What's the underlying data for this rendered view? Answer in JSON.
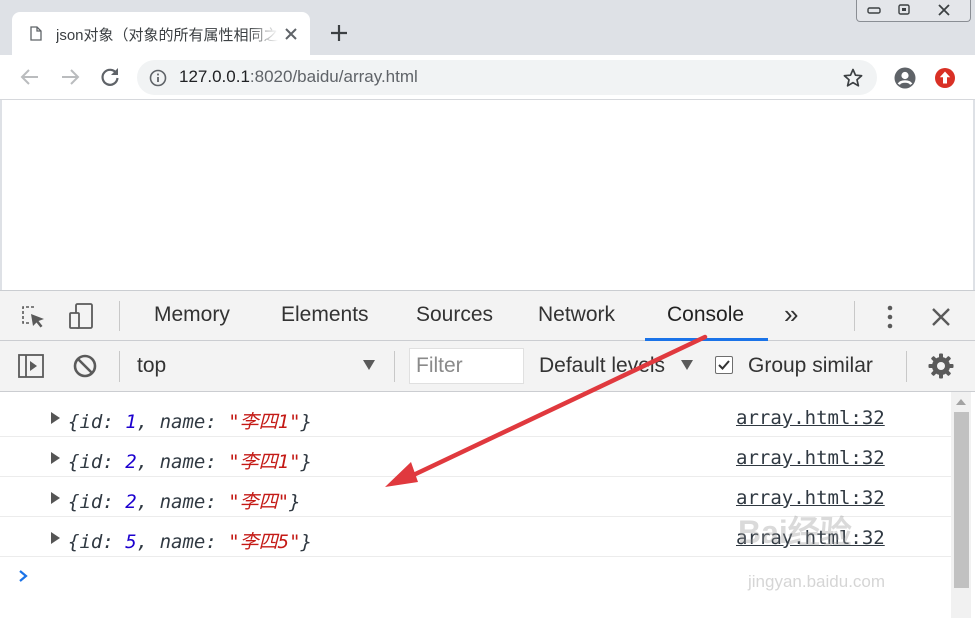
{
  "browser": {
    "tab": {
      "title": "json对象（对象的所有属性相同之"
    },
    "address": {
      "host": "127.0.0.1",
      "rest": ":8020/baidu/array.html"
    }
  },
  "devtools": {
    "tabs": [
      {
        "label": "Memory"
      },
      {
        "label": "Elements"
      },
      {
        "label": "Sources"
      },
      {
        "label": "Network"
      },
      {
        "label": "Console",
        "active": true
      }
    ],
    "overflow_label": "»",
    "toolbar": {
      "context": "top",
      "filter_placeholder": "Filter",
      "levels": "Default levels",
      "group_similar": "Group similar",
      "group_similar_checked": true
    },
    "console": {
      "messages": [
        {
          "open": "{",
          "id_key": "id: ",
          "id": "1",
          "sep": ", ",
          "name_key": "name: ",
          "name": "\"李四1\"",
          "close": "}",
          "source": "array.html:32"
        },
        {
          "open": "{",
          "id_key": "id: ",
          "id": "2",
          "sep": ", ",
          "name_key": "name: ",
          "name": "\"李四1\"",
          "close": "}",
          "source": "array.html:32"
        },
        {
          "open": "{",
          "id_key": "id: ",
          "id": "2",
          "sep": ", ",
          "name_key": "name: ",
          "name": "\"李四\"",
          "close": "}",
          "source": "array.html:32"
        },
        {
          "open": "{",
          "id_key": "id: ",
          "id": "5",
          "sep": ", ",
          "name_key": "name: ",
          "name": "\"李四5\"",
          "close": "}",
          "source": "array.html:32"
        }
      ]
    }
  },
  "watermark": {
    "logo": "Bai经验",
    "url": "jingyan.baidu.com"
  },
  "colors": {
    "accent": "#1a73e8",
    "string": "#c41a16",
    "number": "#1c00cf",
    "annotation_arrow": "#e0393e",
    "update_badge": "#d93025"
  }
}
